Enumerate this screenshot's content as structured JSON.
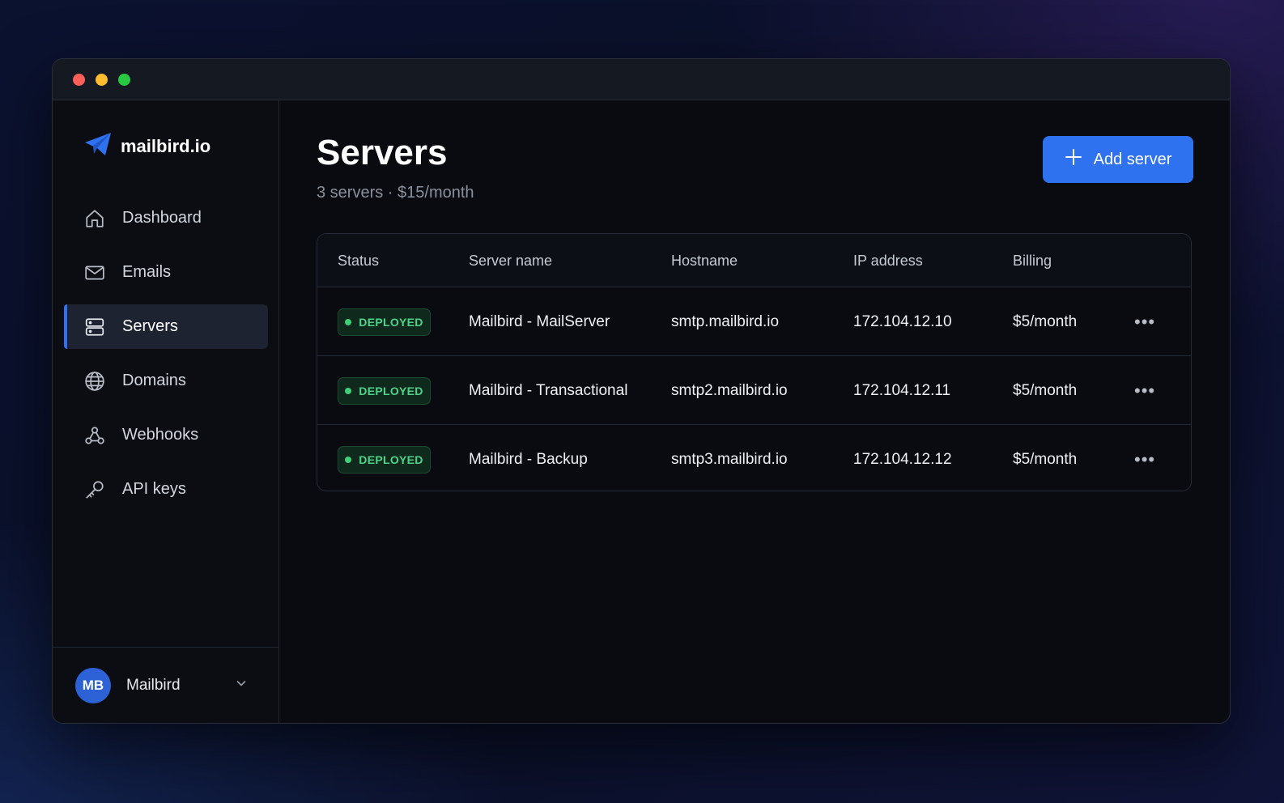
{
  "brand": {
    "name": "mailbird.io",
    "accent": "#2f72f0"
  },
  "window_controls": {
    "close": "#ff5f57",
    "minimize": "#febc2e",
    "zoom": "#28c840"
  },
  "sidebar": {
    "items": [
      {
        "label": "Dashboard",
        "icon": "home-icon",
        "active": false
      },
      {
        "label": "Emails",
        "icon": "mail-icon",
        "active": false
      },
      {
        "label": "Servers",
        "icon": "server-icon",
        "active": true
      },
      {
        "label": "Domains",
        "icon": "globe-icon",
        "active": false
      },
      {
        "label": "Webhooks",
        "icon": "webhook-icon",
        "active": false
      },
      {
        "label": "API keys",
        "icon": "key-icon",
        "active": false
      }
    ],
    "user": {
      "initials": "MB",
      "name": "Mailbird"
    }
  },
  "main": {
    "title": "Servers",
    "subtitle": "3 servers · $15/month",
    "add_button_label": "Add server"
  },
  "table": {
    "columns": [
      "Status",
      "Server name",
      "Hostname",
      "IP address",
      "Billing"
    ],
    "rows": [
      {
        "status": "DEPLOYED",
        "name": "Mailbird - MailServer",
        "hostname": "smtp.mailbird.io",
        "ip": "172.104.12.10",
        "billing": "$5/month"
      },
      {
        "status": "DEPLOYED",
        "name": "Mailbird - Transactional",
        "hostname": "smtp2.mailbird.io",
        "ip": "172.104.12.11",
        "billing": "$5/month"
      },
      {
        "status": "DEPLOYED",
        "name": "Mailbird - Backup",
        "hostname": "smtp3.mailbird.io",
        "ip": "172.104.12.12",
        "billing": "$5/month"
      }
    ],
    "more_label": "•••"
  }
}
